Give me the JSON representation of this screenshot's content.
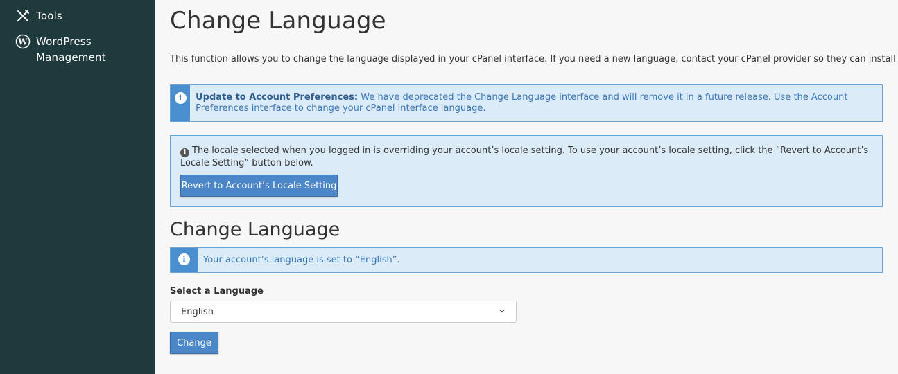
{
  "sidebar": {
    "items": [
      {
        "label": "Tools",
        "icon": "tools-icon"
      },
      {
        "label": "WordPress Management",
        "icon": "wordpress-icon"
      }
    ]
  },
  "page": {
    "title": "Change Language",
    "intro": "This function allows you to change the language displayed in your cPanel interface. If you need a new language, contact your cPanel provider so they can install it."
  },
  "pref_alert": {
    "heading": "Update to Account Preferences:",
    "text_before_link": " We have deprecated the Change Language interface and will remove it in a future release. Use the ",
    "link": "Account Preferences",
    "text_after_link": " interface to change your cPanel interface language."
  },
  "locale_alert": {
    "text": "The locale selected when you logged in is overriding your account’s locale setting. To use your account’s locale setting, click the “Revert to Account’s Locale Setting” button below.",
    "button": "Revert to Account’s Locale Setting"
  },
  "section": {
    "title": "Change Language",
    "status": "Your account’s language is set to “English”."
  },
  "form": {
    "select_label": "Select a Language",
    "selected_language": "English",
    "submit": "Change"
  },
  "colors": {
    "sidebar_bg": "#1f3a3c",
    "info_bg": "#dcebf8",
    "info_accent": "#4a8fd0",
    "button": "#4a86c8"
  }
}
